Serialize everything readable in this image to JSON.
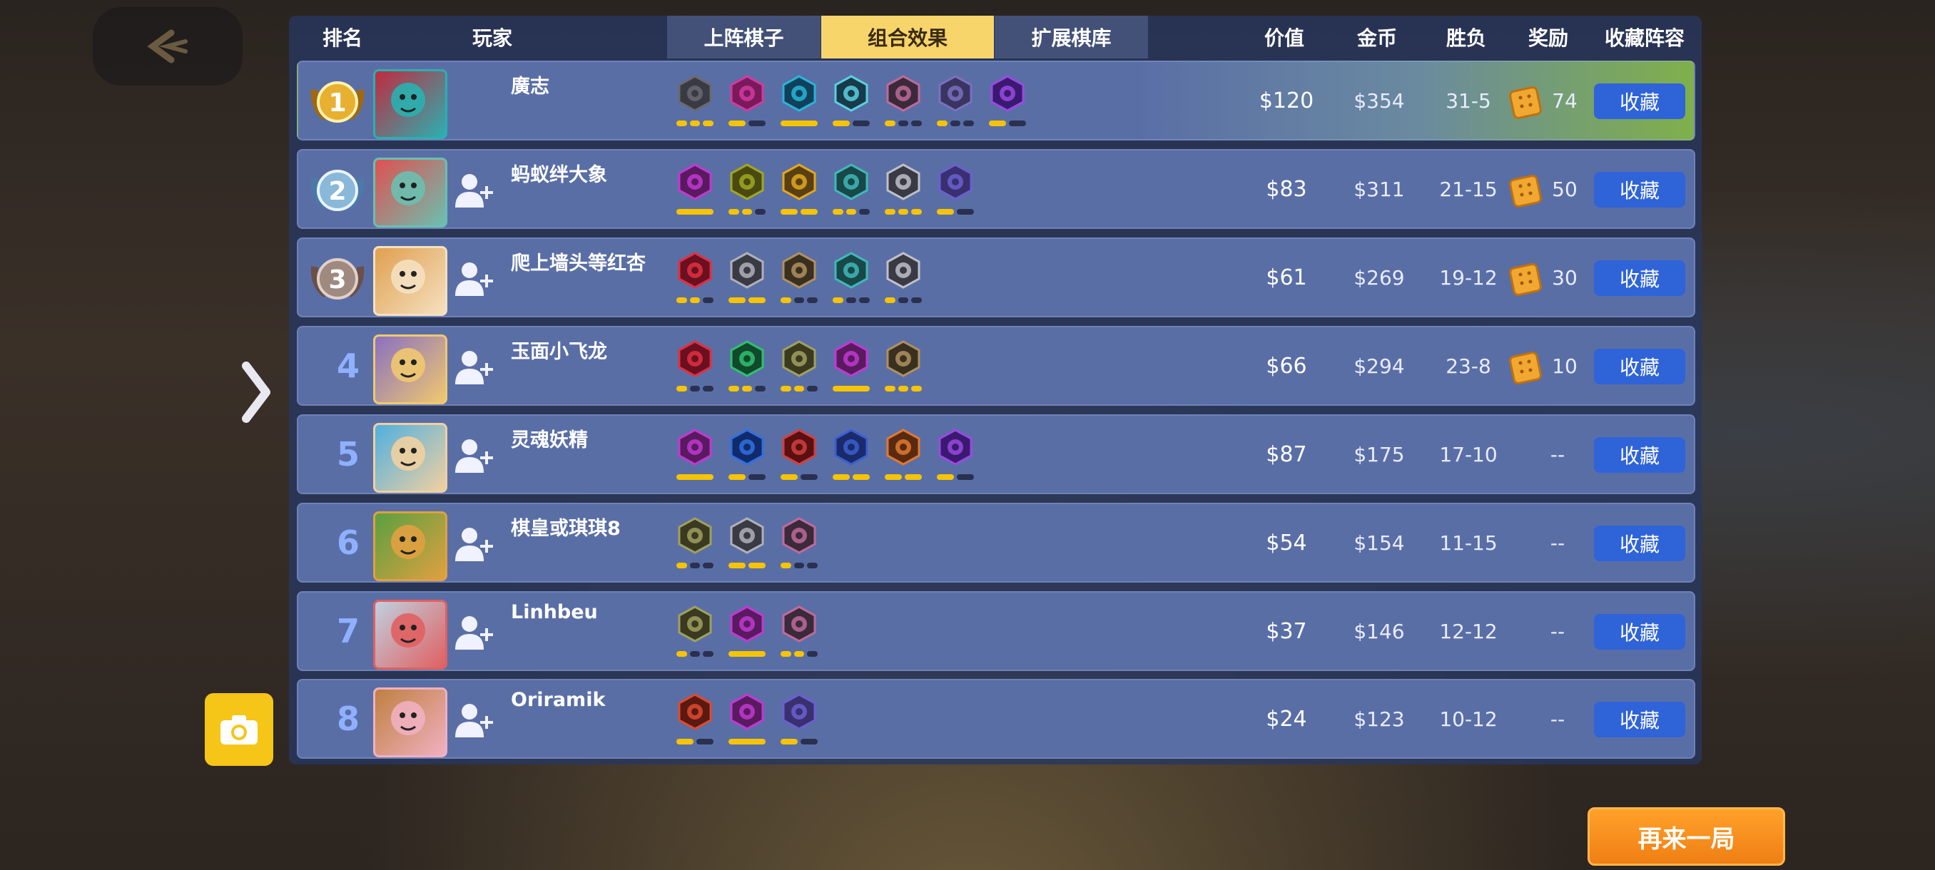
{
  "header": {
    "rank": "排名",
    "player": "玩家",
    "tab_lineup": "上阵棋子",
    "tab_synergy": "组合效果",
    "tab_bench": "扩展棋库",
    "value": "价值",
    "gold": "金币",
    "wl": "胜负",
    "reward": "奖励",
    "collect_lineup": "收藏阵容"
  },
  "buttons": {
    "again": "再来一局",
    "collect": "收藏"
  },
  "rows": [
    {
      "rank": "1",
      "name": "廣志",
      "value": "$120",
      "gold": "$354",
      "wl": "31-5",
      "reward": "74",
      "avatar": "red-demon",
      "medal": "gold",
      "traits": [
        [
          "#3a3a44",
          "#6a6a72",
          3,
          3
        ],
        [
          "#7a1a5a",
          "#d23aa0",
          2,
          1
        ],
        [
          "#10405a",
          "#27b5d8",
          1,
          1
        ],
        [
          "#183a4a",
          "#5ad0e0",
          2,
          1
        ],
        [
          "#3a2a3a",
          "#c06a9a",
          3,
          1
        ],
        [
          "#3a3460",
          "#7a70c0",
          3,
          1
        ],
        [
          "#3a1a70",
          "#9a4ae0",
          2,
          1
        ]
      ]
    },
    {
      "rank": "2",
      "name": "蚂蚁绊大象",
      "value": "$83",
      "gold": "$311",
      "wl": "21-15",
      "reward": "50",
      "avatar": "dragon",
      "medal": "silver",
      "traits": [
        [
          "#5a1a60",
          "#c03ad0",
          1,
          1
        ],
        [
          "#4a4a10",
          "#a0a820",
          3,
          2
        ],
        [
          "#5a4010",
          "#e0a820",
          2,
          2
        ],
        [
          "#184848",
          "#40b8b8",
          3,
          2
        ],
        [
          "#3a3a44",
          "#c0c0c8",
          3,
          3
        ],
        [
          "#3a3070",
          "#6a60d0",
          2,
          1
        ]
      ]
    },
    {
      "rank": "3",
      "name": "爬上墙头等红杏",
      "value": "$61",
      "gold": "$269",
      "wl": "19-12",
      "reward": "30",
      "avatar": "fox",
      "medal": "bronze",
      "traits": [
        [
          "#6a1020",
          "#e03040",
          3,
          2
        ],
        [
          "#3a3a44",
          "#b0b0b8",
          2,
          2
        ],
        [
          "#3a3020",
          "#b09060",
          3,
          1
        ],
        [
          "#184848",
          "#40b8b8",
          3,
          1
        ],
        [
          "#3a3a44",
          "#c0c0c8",
          3,
          1
        ]
      ]
    },
    {
      "rank": "4",
      "name": "玉面小飞龙",
      "value": "$66",
      "gold": "$294",
      "wl": "23-8",
      "reward": "10",
      "avatar": "boy-knight",
      "medal": "",
      "traits": [
        [
          "#6a1020",
          "#e03040",
          3,
          1
        ],
        [
          "#104a2a",
          "#30c070",
          3,
          2
        ],
        [
          "#3a3a20",
          "#a0a060",
          3,
          2
        ],
        [
          "#5a1a60",
          "#c03ad0",
          1,
          1
        ],
        [
          "#3a3020",
          "#b09060",
          3,
          3
        ]
      ]
    },
    {
      "rank": "5",
      "name": "灵魂妖精",
      "value": "$87",
      "gold": "$175",
      "wl": "17-10",
      "reward": "--",
      "avatar": "girl",
      "medal": "",
      "traits": [
        [
          "#5a1a60",
          "#c03ad0",
          1,
          1
        ],
        [
          "#102a6a",
          "#3070e0",
          2,
          1
        ],
        [
          "#5a1010",
          "#d04040",
          2,
          1
        ],
        [
          "#1a2a6a",
          "#3a60d0",
          2,
          2
        ],
        [
          "#5a2a10",
          "#e07a30",
          2,
          2
        ],
        [
          "#3a1a70",
          "#9a4ae0",
          2,
          1
        ]
      ]
    },
    {
      "rank": "6",
      "name": "棋皇或琪琪8",
      "value": "$54",
      "gold": "$154",
      "wl": "11-15",
      "reward": "--",
      "avatar": "dino-kid",
      "medal": "",
      "traits": [
        [
          "#3a3a20",
          "#a0a060",
          3,
          1
        ],
        [
          "#3a3a44",
          "#b0b0b8",
          2,
          2
        ],
        [
          "#3a2a3a",
          "#c06a9a",
          3,
          1
        ]
      ]
    },
    {
      "rank": "7",
      "name": "Linhbeu",
      "value": "$37",
      "gold": "$146",
      "wl": "12-12",
      "reward": "--",
      "avatar": "monkey",
      "medal": "",
      "traits": [
        [
          "#3a3a20",
          "#a0a060",
          3,
          1
        ],
        [
          "#5a1a60",
          "#c03ad0",
          1,
          1
        ],
        [
          "#3a2a3a",
          "#c06a9a",
          3,
          2
        ]
      ]
    },
    {
      "rank": "8",
      "name": "Oriramik",
      "value": "$24",
      "gold": "$123",
      "wl": "10-12",
      "reward": "--",
      "avatar": "princess",
      "medal": "",
      "traits": [
        [
          "#5a1a10",
          "#e04a30",
          2,
          1
        ],
        [
          "#5a1a60",
          "#c03ad0",
          1,
          1
        ],
        [
          "#3a3070",
          "#6a60d0",
          2,
          1
        ]
      ]
    }
  ]
}
